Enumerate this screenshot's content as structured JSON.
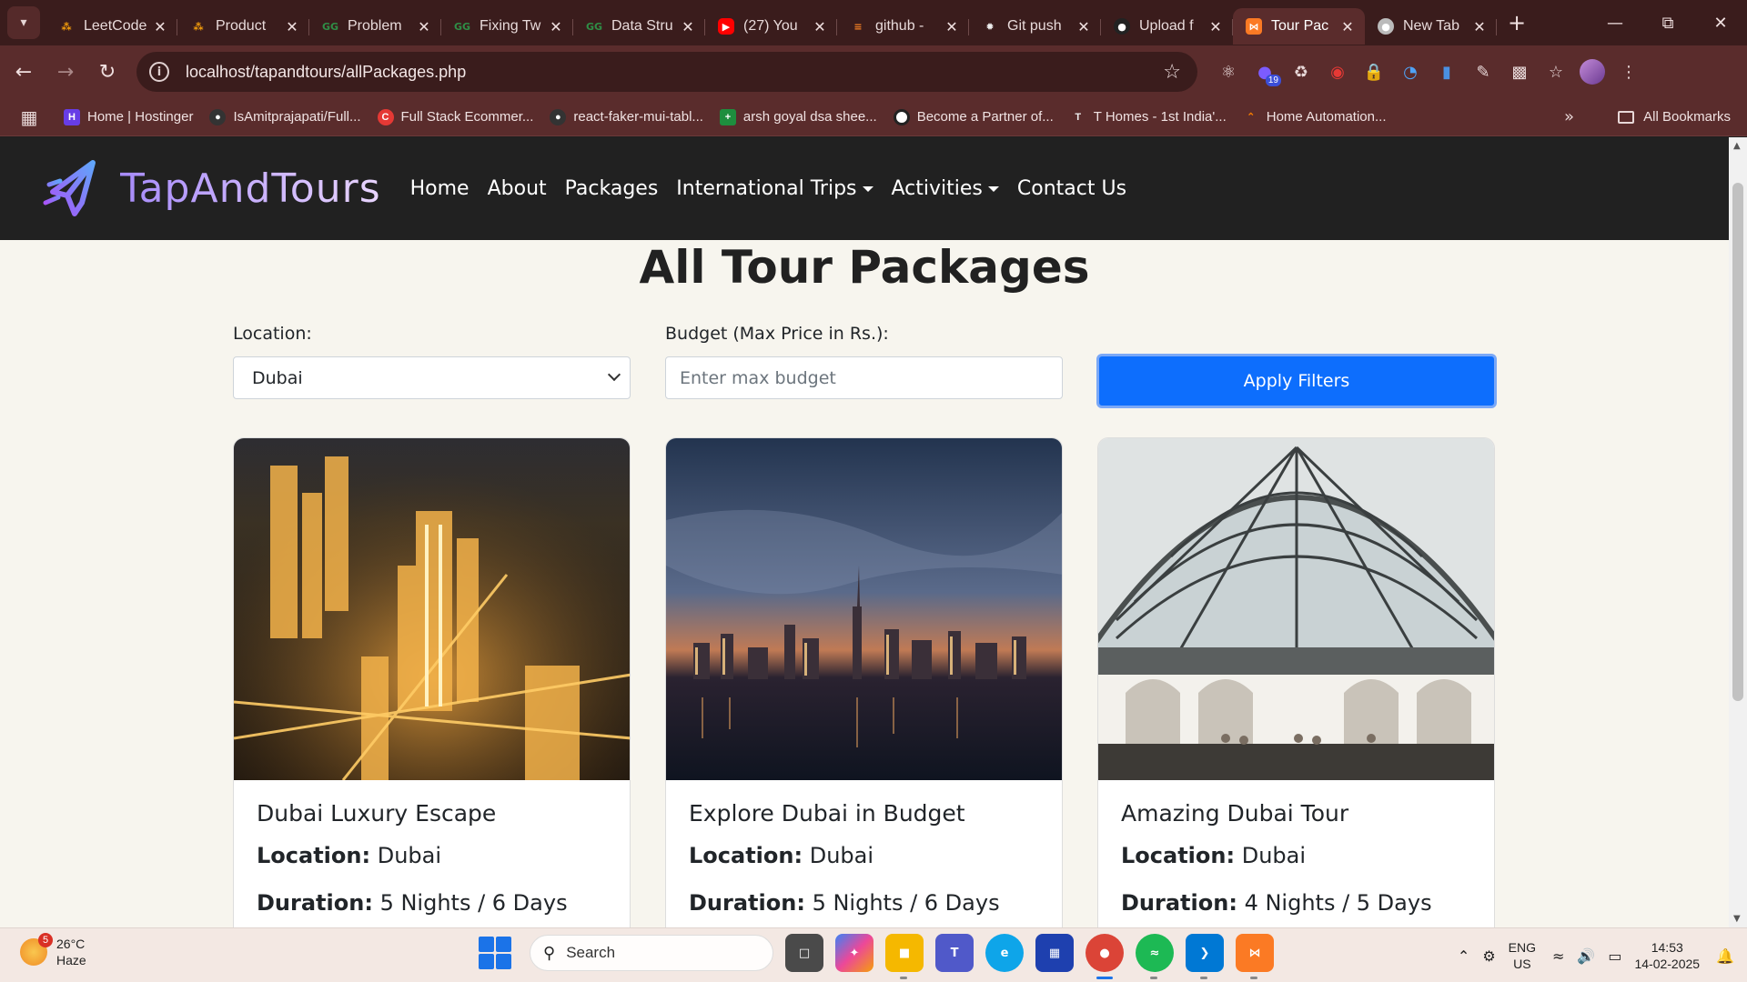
{
  "browser": {
    "tabs": [
      {
        "title": "LeetCode",
        "favicon": "leetcode-icon",
        "color": "#f59e0b"
      },
      {
        "title": "Product",
        "favicon": "leetcode-icon",
        "color": "#f59e0b"
      },
      {
        "title": "Problem",
        "favicon": "geeksforgeeks-icon",
        "color": "#2f8d46"
      },
      {
        "title": "Fixing Tw",
        "favicon": "geeksforgeeks-icon",
        "color": "#2f8d46"
      },
      {
        "title": "Data Stru",
        "favicon": "geeksforgeeks-icon",
        "color": "#2f8d46"
      },
      {
        "title": "(27) You",
        "favicon": "youtube-icon",
        "color": "#ff0000"
      },
      {
        "title": "github -",
        "favicon": "stackoverflow-icon",
        "color": "#f48024"
      },
      {
        "title": "Git push",
        "favicon": "openai-icon",
        "color": "#444444"
      },
      {
        "title": "Upload f",
        "favicon": "github-icon",
        "color": "#444444"
      },
      {
        "title": "Tour Pac",
        "favicon": "xampp-icon",
        "color": "#fb7a24",
        "active": true
      },
      {
        "title": "New Tab",
        "favicon": "chrome-icon",
        "color": "#888888"
      }
    ],
    "url": "localhost/tapandtours/allPackages.php",
    "extension_badge": "19",
    "bookmarks": [
      {
        "label": "Home | Hostinger",
        "color": "#673de6"
      },
      {
        "label": "IsAmitprajapati/Full...",
        "color": "#333333"
      },
      {
        "label": "Full Stack Ecommer...",
        "color": "#e53935"
      },
      {
        "label": "react-faker-mui-tabl...",
        "color": "#333333"
      },
      {
        "label": "arsh goyal dsa shee...",
        "color": "#1e8e3e"
      },
      {
        "label": "Become a Partner of...",
        "color": "#ffffff"
      },
      {
        "label": "T Homes - 1st India'...",
        "color": "#333333"
      },
      {
        "label": "Home Automation...",
        "color": "#f57c00"
      }
    ],
    "all_bookmarks": "All Bookmarks"
  },
  "site": {
    "brand": "TapAndTours",
    "nav": [
      {
        "label": "Home",
        "dropdown": false
      },
      {
        "label": "About",
        "dropdown": false
      },
      {
        "label": "Packages",
        "dropdown": false
      },
      {
        "label": "International Trips",
        "dropdown": true
      },
      {
        "label": "Activities",
        "dropdown": true
      },
      {
        "label": "Contact Us",
        "dropdown": false
      }
    ],
    "page_title": "All Tour Packages",
    "filters": {
      "location_label": "Location:",
      "location_value": "Dubai",
      "budget_label": "Budget (Max Price in Rs.):",
      "budget_placeholder": "Enter max budget",
      "apply_label": "Apply Filters"
    },
    "labels": {
      "location": "Location:",
      "duration": "Duration:"
    },
    "packages": [
      {
        "title": "Dubai Luxury Escape",
        "location": "Dubai",
        "duration": "5 Nights / 6 Days",
        "image": "night-city-aerial"
      },
      {
        "title": "Explore Dubai in Budget",
        "location": "Dubai",
        "duration": "5 Nights / 6 Days",
        "image": "skyline-dusk"
      },
      {
        "title": "Amazing Dubai Tour",
        "location": "Dubai",
        "duration": "4 Nights / 5 Days",
        "image": "mall-glass-dome"
      }
    ]
  },
  "taskbar": {
    "weather_temp": "26°C",
    "weather_desc": "Haze",
    "weather_badge": "5",
    "search": "Search",
    "lang": "ENG",
    "region": "US",
    "time": "14:53",
    "date": "14-02-2025"
  }
}
